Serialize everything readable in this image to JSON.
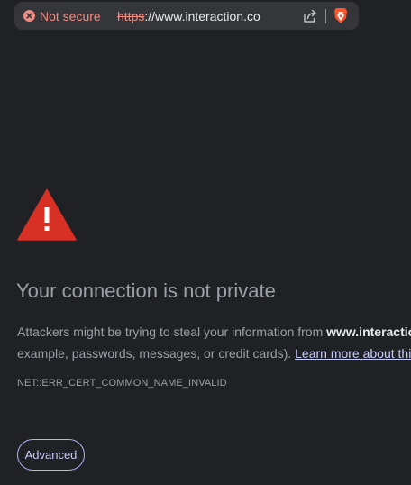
{
  "address_bar": {
    "security_label": "Not secure",
    "url_scheme": "https",
    "url_separator": "://",
    "url_host": "www.interaction.co",
    "icons": [
      "not-secure-icon",
      "share-icon",
      "brave-shields-icon"
    ]
  },
  "error_page": {
    "title": "Your connection is not private",
    "description_part1": "Attackers might be trying to steal your information from ",
    "description_host": "www.interaction.co",
    "description_part2": "example, passwords, messages, or credit cards). ",
    "learn_more_link": "Learn more about this warning",
    "error_code": "NET::ERR_CERT_COMMON_NAME_INVALID",
    "advanced_button": "Advanced",
    "icon": "warning-triangle-icon"
  },
  "colors": {
    "background": "#202124",
    "omnibox": "#35363a",
    "not_secure": "#f28b82",
    "warning": "#d93025",
    "text_secondary": "#9aa0a6",
    "text_primary": "#e8eaed",
    "link": "#c9cdfa"
  }
}
